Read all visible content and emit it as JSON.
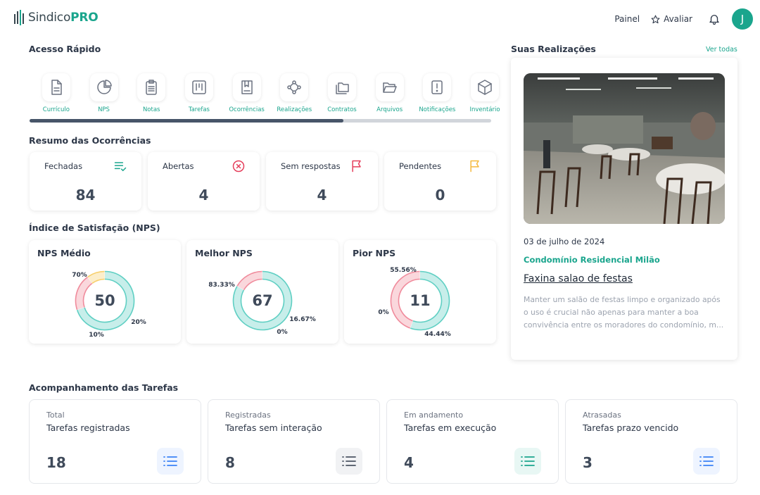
{
  "header": {
    "logo_plain": "Sindico",
    "logo_bold": "PRO",
    "nav_painel": "Painel",
    "nav_avaliar": "Avaliar",
    "avatar_initial": "J"
  },
  "quick_access": {
    "title": "Acesso Rápido",
    "items": [
      {
        "label": "Currículo",
        "icon": "document-icon"
      },
      {
        "label": "NPS",
        "icon": "pie-chart-icon"
      },
      {
        "label": "Notas",
        "icon": "clipboard-icon"
      },
      {
        "label": "Tarefas",
        "icon": "kanban-icon"
      },
      {
        "label": "Ocorrências",
        "icon": "book-icon"
      },
      {
        "label": "Realizações",
        "icon": "network-icon"
      },
      {
        "label": "Contratos",
        "icon": "folders-icon"
      },
      {
        "label": "Arquivos",
        "icon": "folder-open-icon"
      },
      {
        "label": "Notificações",
        "icon": "alert-file-icon"
      },
      {
        "label": "Inventário",
        "icon": "box-icon"
      }
    ],
    "scroll_position": 0.68
  },
  "occurrences": {
    "title": "Resumo das Ocorrências",
    "cards": [
      {
        "label": "Fechadas",
        "value": "84",
        "icon": "list-check-icon",
        "color": "#1aa58d"
      },
      {
        "label": "Abertas",
        "value": "4",
        "icon": "x-circle-icon",
        "color": "#e53e5b"
      },
      {
        "label": "Sem respostas",
        "value": "4",
        "icon": "flag-icon",
        "color": "#e53e5b"
      },
      {
        "label": "Pendentes",
        "value": "0",
        "icon": "flag-icon",
        "color": "#f5b93c"
      }
    ]
  },
  "nps": {
    "title": "Índice de Satisfação (NPS)",
    "cards": [
      {
        "title": "NPS Médio",
        "score": "50",
        "segments": [
          {
            "label": "70%",
            "value": 70,
            "color": "#5fcfc3"
          },
          {
            "label": "20%",
            "value": 20,
            "color": "#f08b9c"
          },
          {
            "label": "10%",
            "value": 10,
            "color": "#f7cf6b"
          }
        ]
      },
      {
        "title": "Melhor NPS",
        "score": "67",
        "segments": [
          {
            "label": "83.33%",
            "value": 83.33,
            "color": "#5fcfc3"
          },
          {
            "label": "16.67%",
            "value": 16.67,
            "color": "#f08b9c"
          },
          {
            "label": "0%",
            "value": 0,
            "color": "#f7cf6b"
          }
        ]
      },
      {
        "title": "Pior NPS",
        "score": "11",
        "segments": [
          {
            "label": "55.56%",
            "value": 55.56,
            "color": "#5fcfc3"
          },
          {
            "label": "44.44%",
            "value": 44.44,
            "color": "#f08b9c"
          },
          {
            "label": "0%",
            "value": 0,
            "color": "#f7cf6b"
          }
        ]
      }
    ]
  },
  "achievements": {
    "title": "Suas Realizações",
    "see_all": "Ver todas",
    "date": "03 de julho de 2024",
    "condo": "Condomínio Residencial Milão",
    "item_title": "Faxina salao de festas",
    "description": "Manter um salão de festas limpo e organizado após o uso é crucial não apenas para manter a boa convivência entre os moradores do condomínio, m..."
  },
  "tasks": {
    "title": "Acompanhamento das Tarefas",
    "cards": [
      {
        "kicker": "Total",
        "title": "Tarefas registradas",
        "value": "18",
        "icon_color": "#3b82f6",
        "icon_bg": "#eef4ff"
      },
      {
        "kicker": "Registradas",
        "title": "Tarefas sem interação",
        "value": "8",
        "icon_color": "#4b5563",
        "icon_bg": "#f1f2f4"
      },
      {
        "kicker": "Em andamento",
        "title": "Tarefas em execução",
        "value": "4",
        "icon_color": "#1aa58d",
        "icon_bg": "#e8f7f4"
      },
      {
        "kicker": "Atrasadas",
        "title": "Tarefas prazo vencido",
        "value": "3",
        "icon_color": "#3b82f6",
        "icon_bg": "#eef4ff"
      }
    ]
  }
}
